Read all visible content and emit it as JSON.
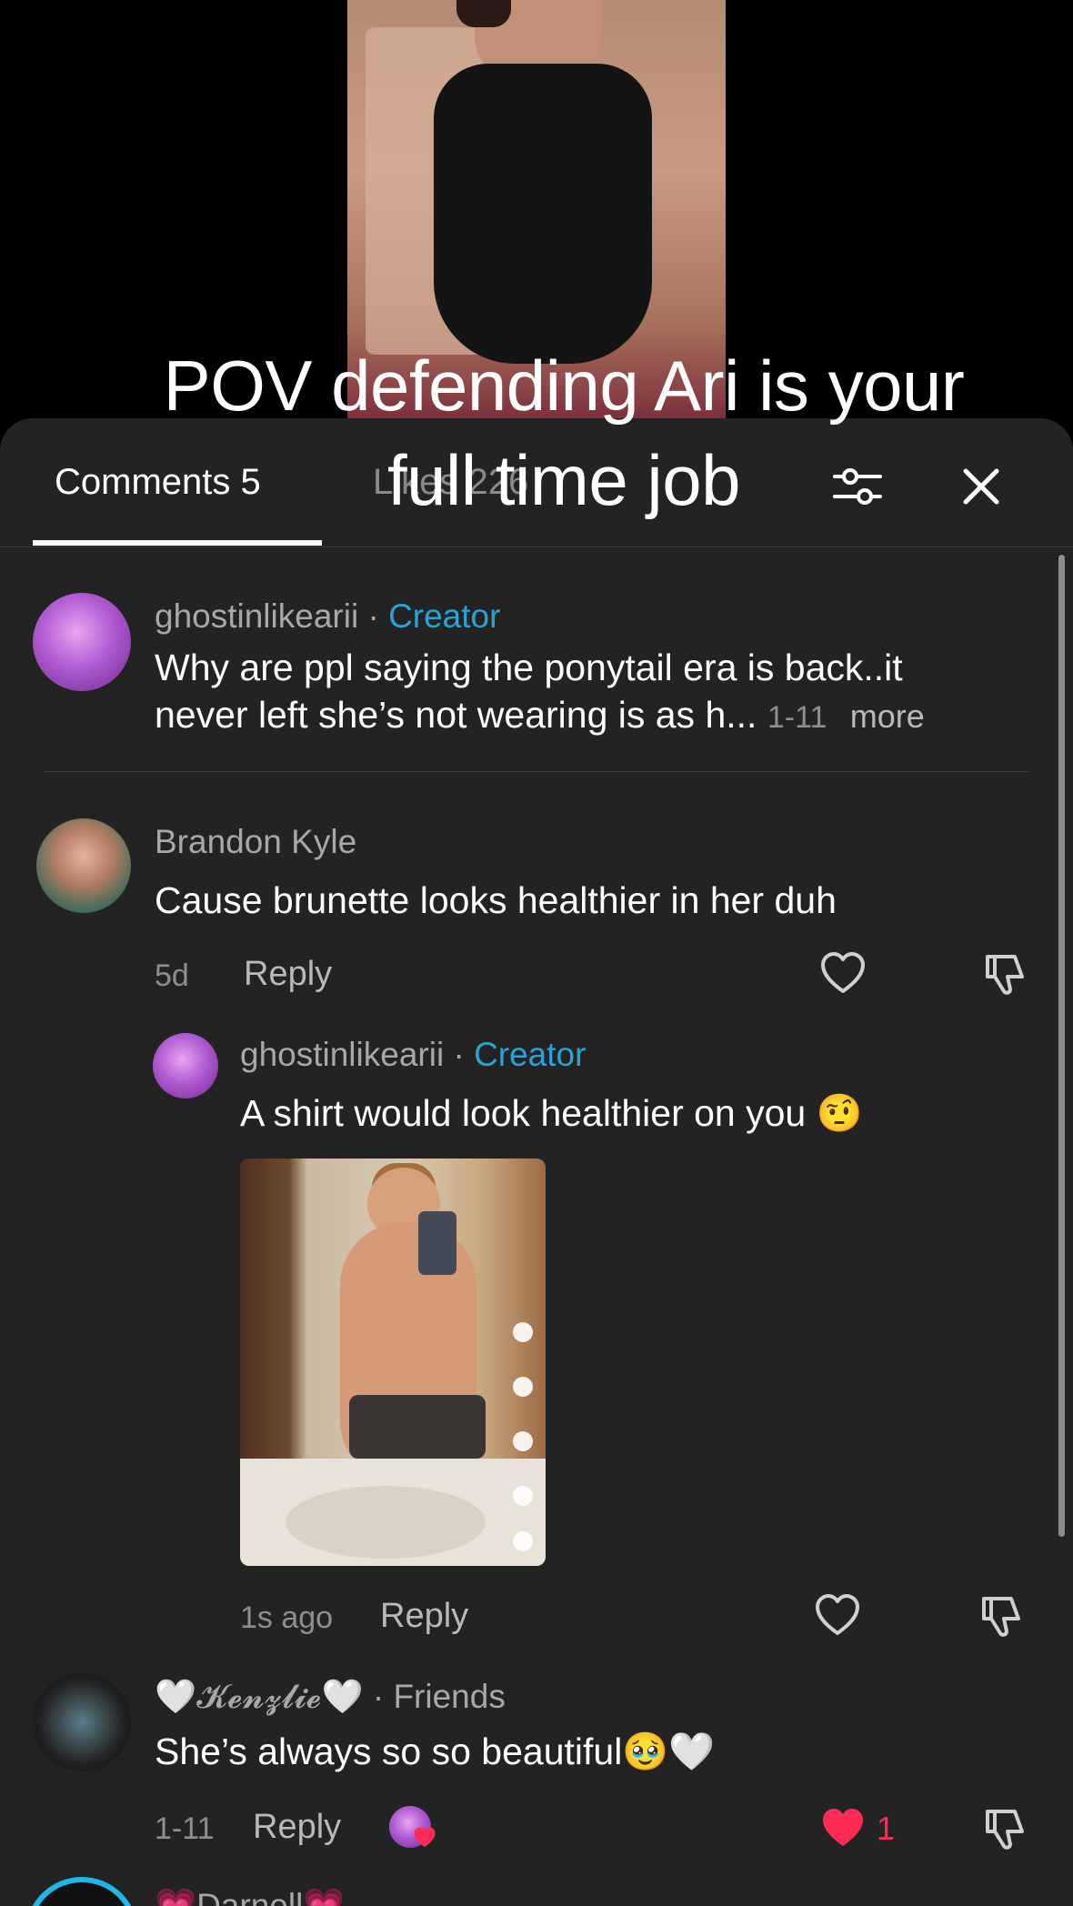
{
  "video": {
    "caption_line1": "POV defending Ari is your",
    "caption_line2": "full time job"
  },
  "tabs": {
    "comments": "Comments 5",
    "likes": "Likes 226"
  },
  "icons": {
    "filter": "sliders-icon",
    "close": "close-icon",
    "like": "heart-icon",
    "dislike": "dislike-icon"
  },
  "colors": {
    "panel_bg": "#232323",
    "creator_accent": "#27a4d9",
    "liked_heart": "#fe2c55"
  },
  "comments": [
    {
      "username": "ghostinlikearii",
      "separator": "·",
      "tag": "Creator",
      "text_line1": "Why are ppl saying the ponytail era is back..it",
      "text_line2": "never left she’s not wearing is as h...",
      "date": "1-11",
      "more": "more"
    },
    {
      "username": "Brandon Kyle",
      "text": "Cause brunette looks healthier in her duh",
      "date": "5d",
      "reply_label": "Reply",
      "reply": {
        "username": "ghostinlikearii",
        "separator": "·",
        "tag": "Creator",
        "text": "A shirt would look healthier on you 🤨",
        "date": "1s ago",
        "reply_label": "Reply"
      }
    },
    {
      "username": "🤍𝓚𝓮𝓷𝔃𝓵𝓲𝓮🤍",
      "separator": "·",
      "tag": "Friends",
      "text": "She’s always so so beautiful🥹🤍",
      "date": "1-11",
      "reply_label": "Reply",
      "like_count": "1"
    }
  ],
  "next_comment_peek": "💗Darnell💗"
}
